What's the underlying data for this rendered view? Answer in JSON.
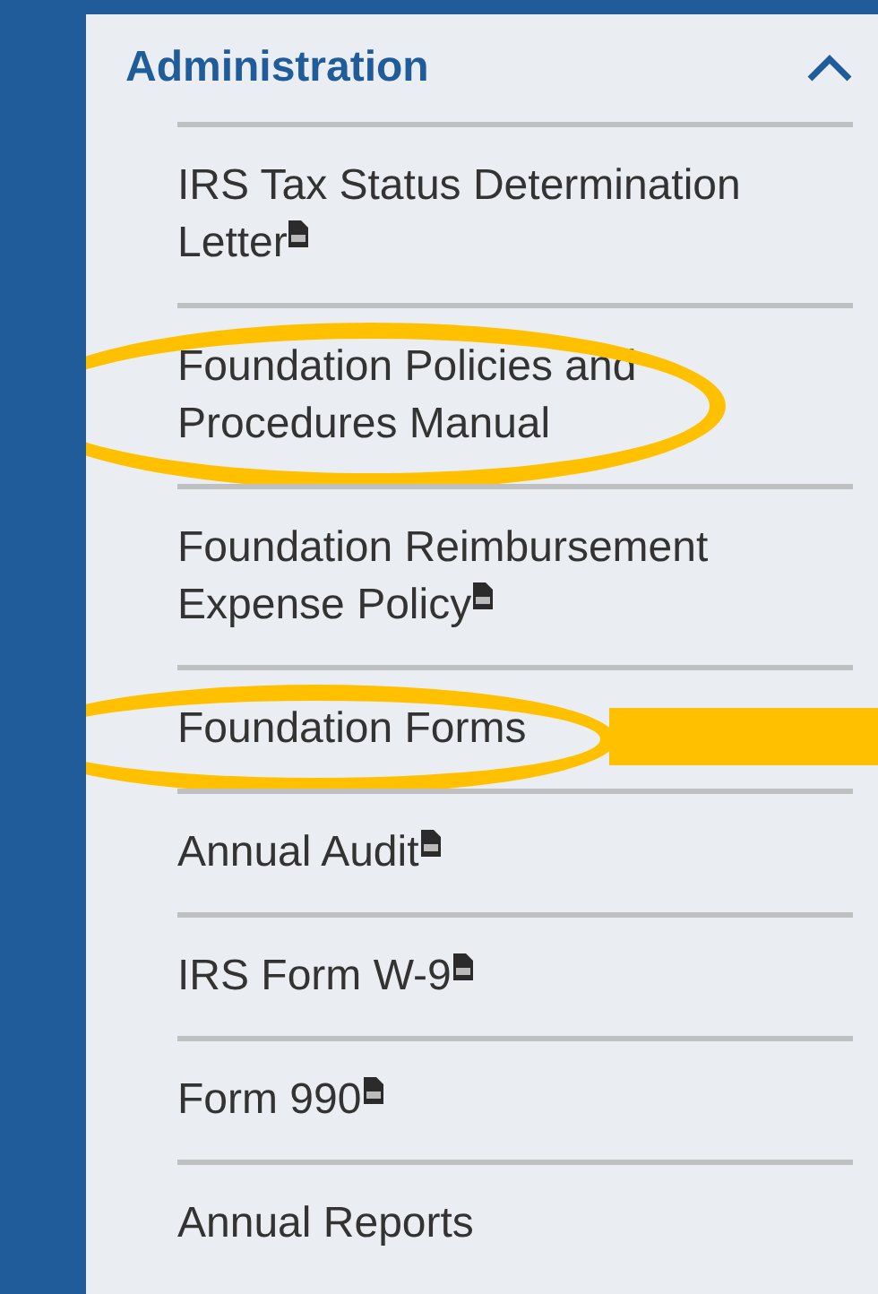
{
  "section": {
    "title": "Administration",
    "expanded": true
  },
  "items": [
    {
      "label": "IRS Tax Status Determination Letter",
      "pdf": true,
      "highlighted": false,
      "pointer": false
    },
    {
      "label": "Foundation Policies and Procedures Manual",
      "pdf": false,
      "highlighted": true,
      "pointer": false
    },
    {
      "label": "Foundation Reimbursement Expense Policy",
      "pdf": true,
      "highlighted": false,
      "pointer": false
    },
    {
      "label": "Foundation Forms",
      "pdf": false,
      "highlighted": true,
      "pointer": true
    },
    {
      "label": "Annual Audit",
      "pdf": true,
      "highlighted": false,
      "pointer": false
    },
    {
      "label": "IRS Form W-9",
      "pdf": true,
      "highlighted": false,
      "pointer": false
    },
    {
      "label": "Form 990",
      "pdf": true,
      "highlighted": false,
      "pointer": false
    },
    {
      "label": "Annual Reports",
      "pdf": false,
      "highlighted": false,
      "pointer": false
    }
  ]
}
